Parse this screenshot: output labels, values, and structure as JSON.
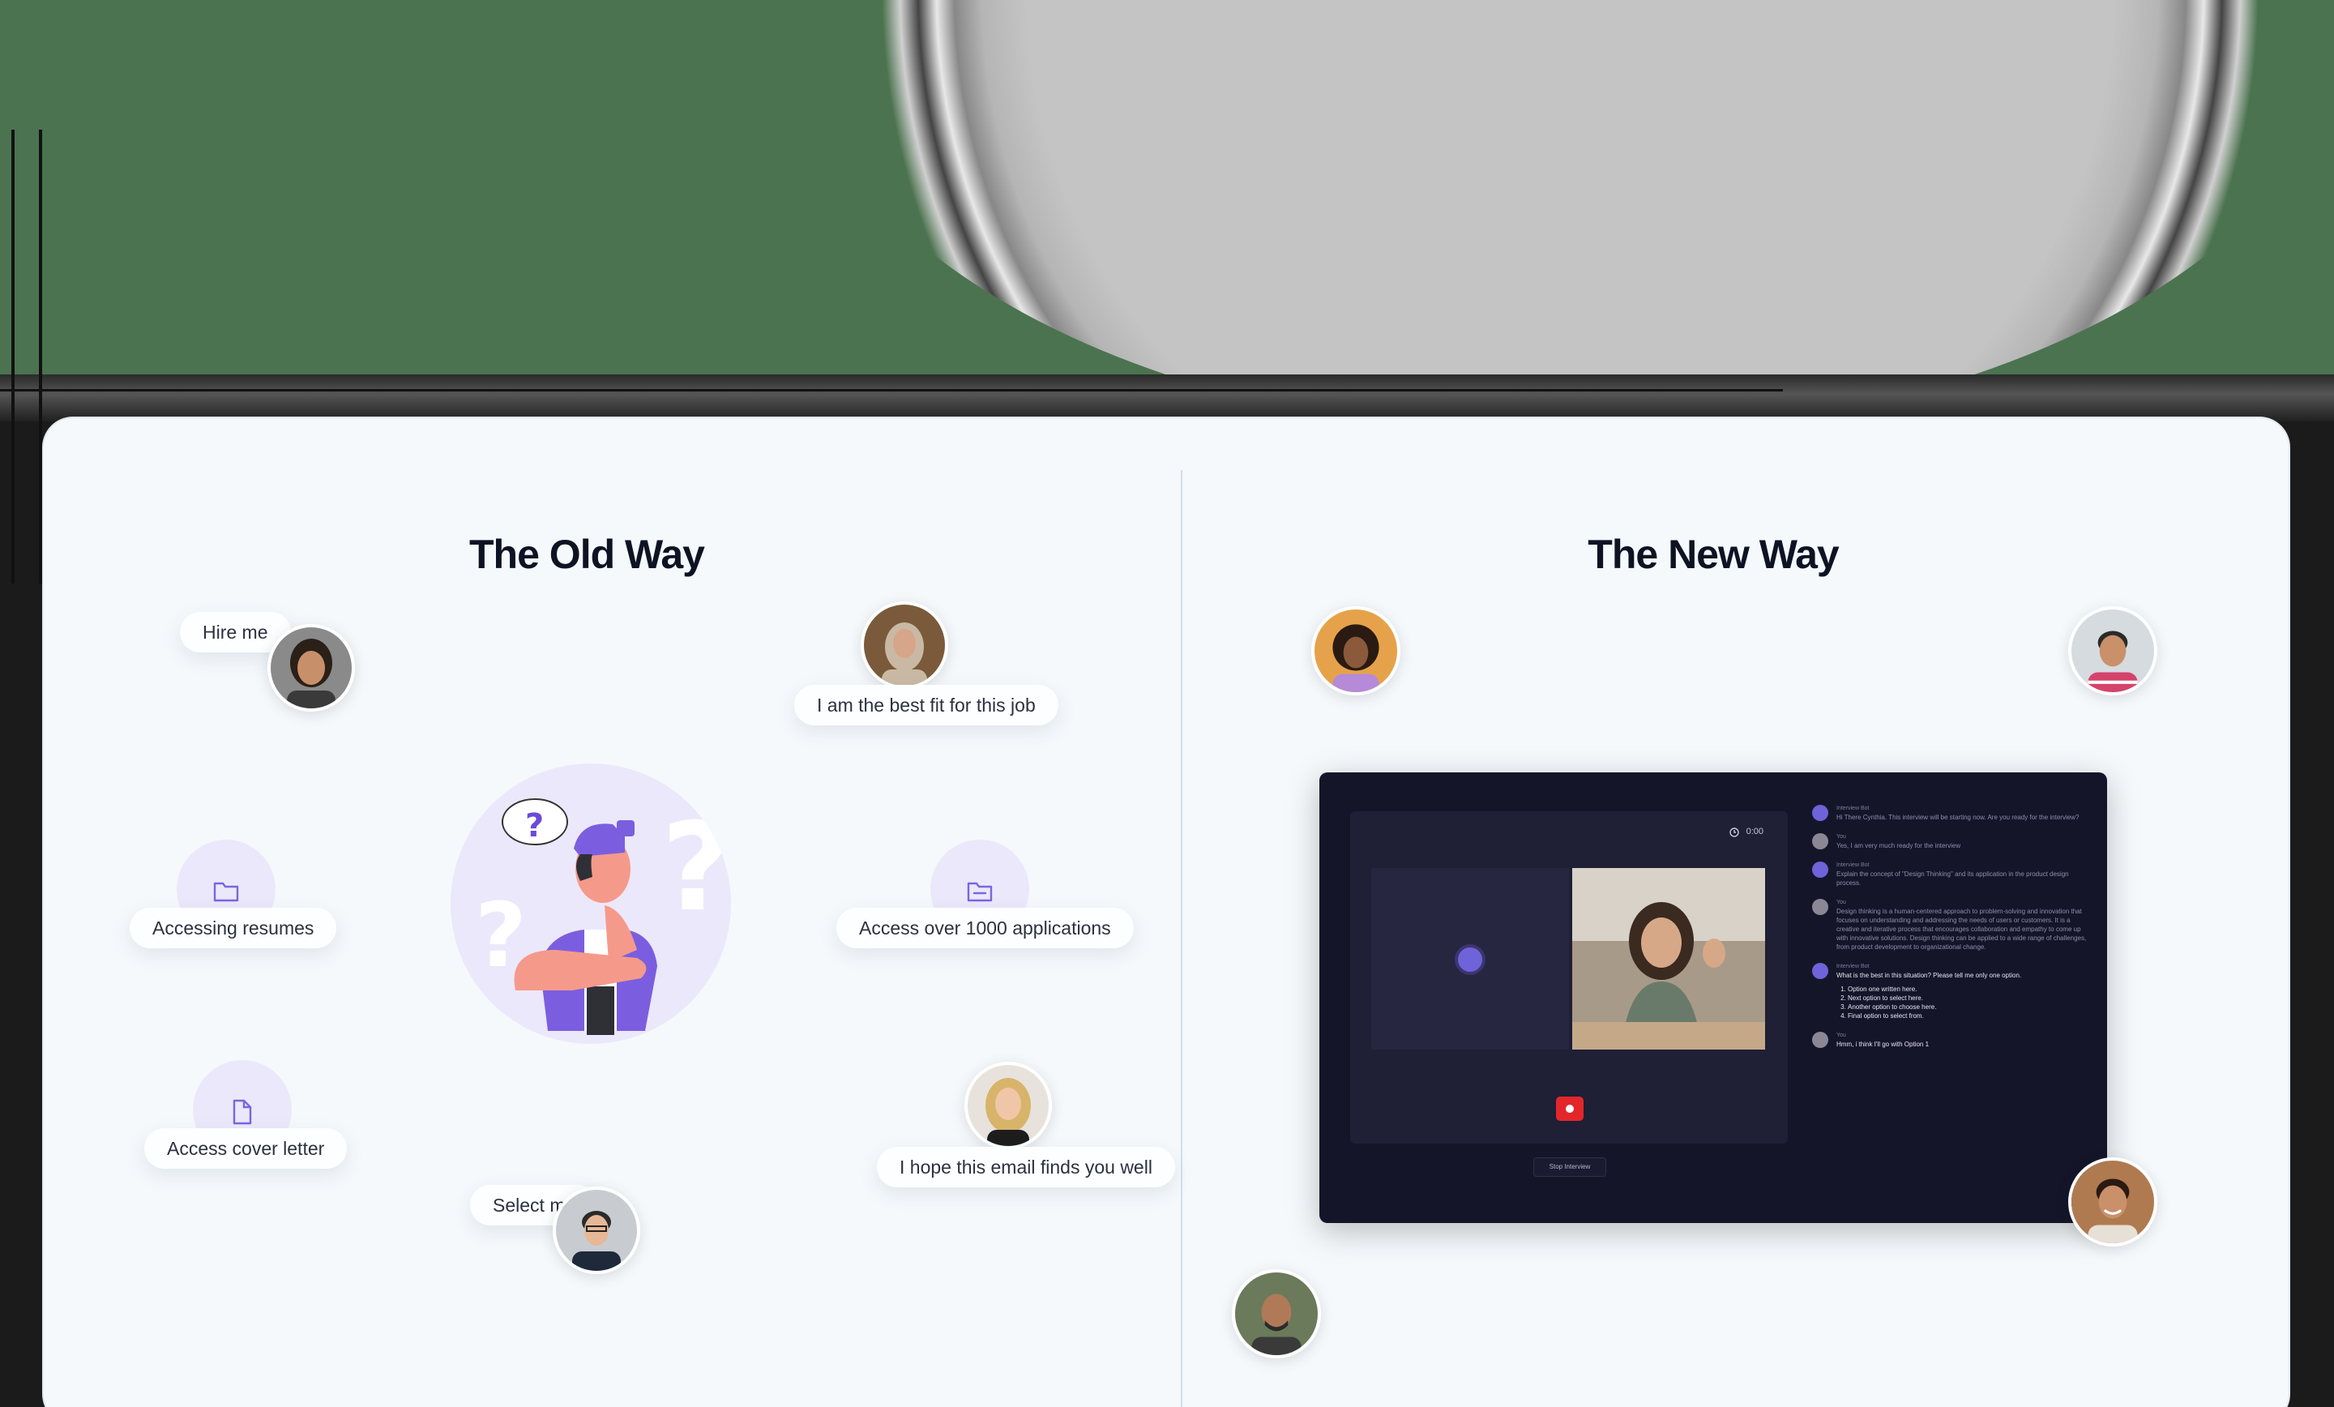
{
  "colors": {
    "card_bg": "#f5f9fc",
    "heading": "#0e1324",
    "accent_purple": "#6f63d9",
    "app_bg": "#15152a",
    "record_red": "#e3262a"
  },
  "old_way": {
    "title": "The Old Way",
    "bubbles": [
      {
        "text": "Hire me"
      },
      {
        "text": "I am the best fit for this job"
      },
      {
        "text": "Accessing resumes",
        "icon": "folder-icon"
      },
      {
        "text": "Access over 1000 applications",
        "icon": "folder-open-icon"
      },
      {
        "text": "Access cover letter",
        "icon": "document-icon"
      },
      {
        "text": "I hope this email finds you well"
      },
      {
        "text": "Select me"
      }
    ],
    "illustration": {
      "icon": "confused-person-illustration",
      "glyph": "?"
    }
  },
  "new_way": {
    "title": "The New Way",
    "app": {
      "timer": "0:00",
      "stop_button": "Stop Interview",
      "chat": [
        {
          "sender": "Interview Bot",
          "text": "Hi There Cynthia. This interview will be starting now. Are you ready for the interview?"
        },
        {
          "sender": "You",
          "text": "Yes, I am very much ready for the interview"
        },
        {
          "sender": "Interview Bot",
          "text": "Explain the concept of \"Design Thinking\" and its application in the product design process."
        },
        {
          "sender": "You",
          "text": "Design thinking is a human-centered approach to problem-solving and innovation that focuses on understanding and addressing the needs of users or customers. It is a creative and iterative process that encourages collaboration and empathy to come up with innovative solutions. Design thinking can be applied to a wide range of challenges, from product development to organizational change."
        },
        {
          "sender": "Interview Bot",
          "text": "What is the best in this situation? Please tell me only one option.",
          "options": [
            "Option one written here.",
            "Next option to select here.",
            "Another option to choose here.",
            "Final option to select from."
          ]
        },
        {
          "sender": "You",
          "text": "Hmm, i think I'll go with Option 1"
        }
      ]
    }
  }
}
